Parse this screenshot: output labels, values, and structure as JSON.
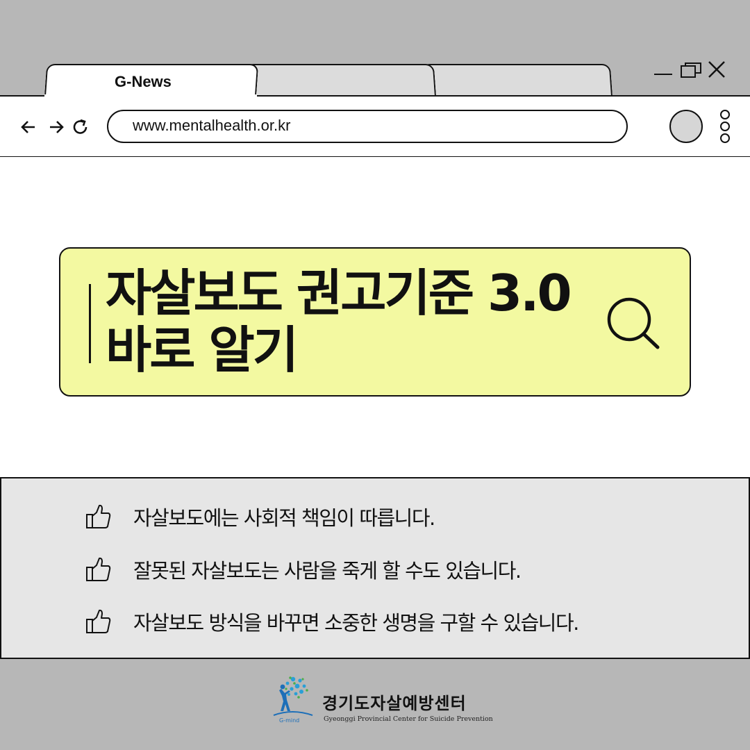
{
  "browser": {
    "tabs": [
      {
        "label": "G-News",
        "active": true
      },
      {
        "label": "",
        "active": false
      },
      {
        "label": "",
        "active": false
      }
    ],
    "address": "www.mentalhealth.or.kr",
    "window_controls": [
      "minimize-icon",
      "maximize-icon",
      "close-icon"
    ],
    "nav_icons": [
      "back-arrow-icon",
      "forward-arrow-icon",
      "reload-icon"
    ],
    "menu_icon": "kebab-menu-icon"
  },
  "hero": {
    "line1": "자살보도 권고기준 3.0",
    "line2": "바로 알기",
    "icon": "search-icon",
    "background_color": "#f3f9a1"
  },
  "info": {
    "icon": "thumbs-up-icon",
    "items": [
      "자살보도에는 사회적 책임이 따릅니다.",
      "잘못된 자살보도는 사람을 죽게 할 수도 있습니다.",
      "자살보도 방식을 바꾸면 소중한 생명을 구할 수 있습니다."
    ]
  },
  "footer": {
    "logo_name": "경기도자살예방센터",
    "logo_subtitle": "Gyeonggi Provincial Center for Suicide Prevention",
    "logo_mark_text": "G-mind"
  },
  "colors": {
    "page_background": "#b7b7b7",
    "panel_background": "#e6e6e6",
    "accent": "#f3f9a1"
  }
}
